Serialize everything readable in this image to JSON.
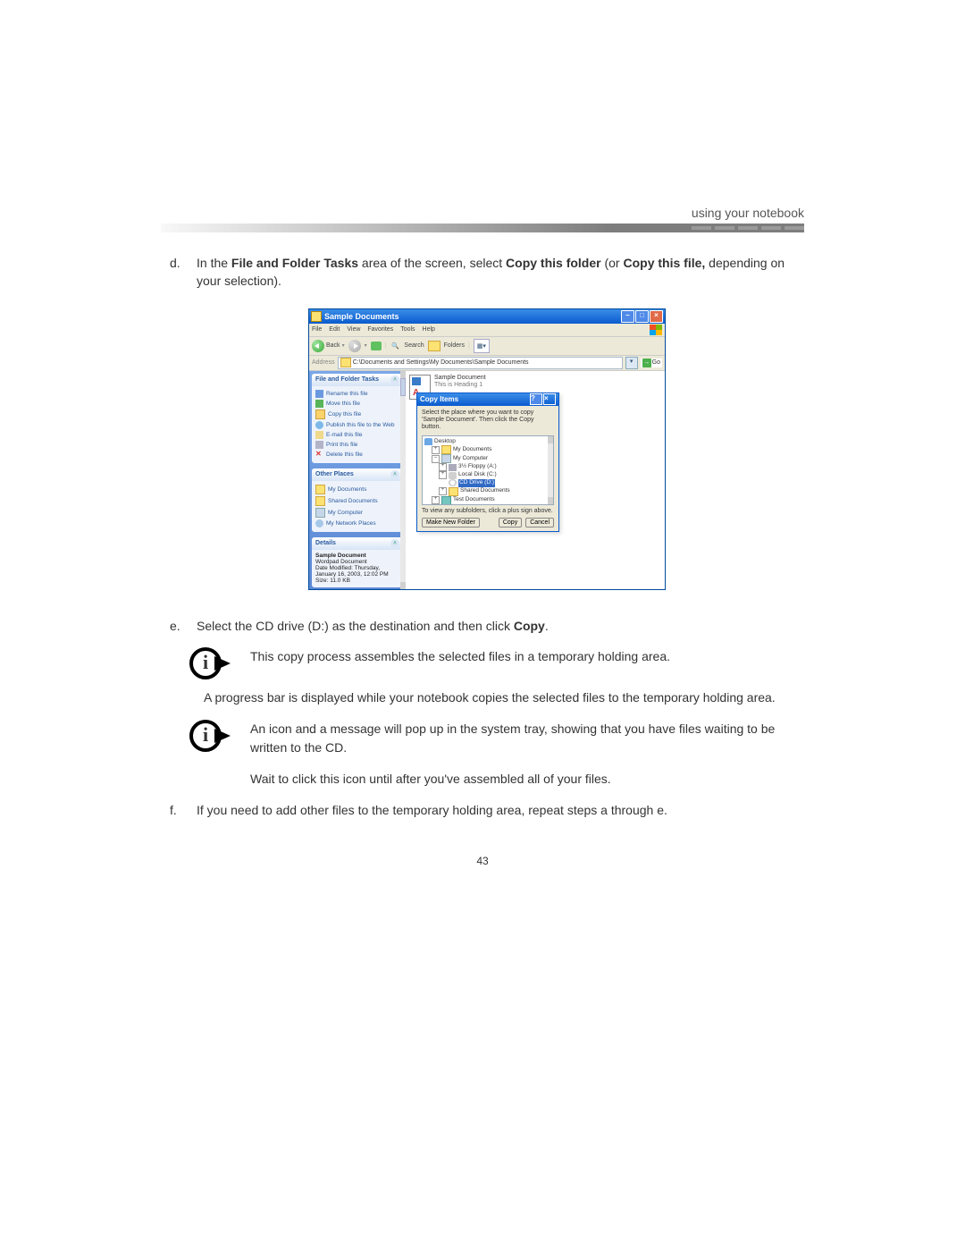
{
  "header": {
    "title": "using your notebook"
  },
  "steps": {
    "d": {
      "letter": "d.",
      "part1": "In the ",
      "bold1": "File and Folder Tasks",
      "part2": " area of the screen, select ",
      "bold2": "Copy this folder",
      "part3": " (or ",
      "bold3": "Copy this file,",
      "part4": " depending on your selection)."
    },
    "e": {
      "letter": "e.",
      "part1": "Select the CD drive (D:) as the destination and then click ",
      "bold1": "Copy",
      "part2": "."
    },
    "f": {
      "letter": "f.",
      "text": "If you need to add other files to the temporary holding area, repeat steps a through e."
    }
  },
  "notes": {
    "n1": "This copy process assembles the selected files in a temporary holding area.",
    "after_n1": "A progress bar is displayed while your notebook copies the selected files to the temporary holding area.",
    "n2a": "An icon and a message will pop up in the system tray, showing that you have files waiting to be written to the CD.",
    "n2b": "Wait to click this icon until after you've assembled all of your files."
  },
  "page_number": "43",
  "xp": {
    "title": "Sample Documents",
    "menu": [
      "File",
      "Edit",
      "View",
      "Favorites",
      "Tools",
      "Help"
    ],
    "toolbar": {
      "back": "Back",
      "search": "Search",
      "folders": "Folders"
    },
    "address": {
      "label": "Address",
      "path": "C:\\Documents and Settings\\My Documents\\Sample Documents",
      "go": "Go"
    },
    "sidebar": {
      "panel1": {
        "title": "File and Folder Tasks",
        "items": [
          "Rename this file",
          "Move this file",
          "Copy this file",
          "Publish this file to the Web",
          "E-mail this file",
          "Print this file",
          "Delete this file"
        ]
      },
      "panel2": {
        "title": "Other Places",
        "items": [
          "My Documents",
          "Shared Documents",
          "My Computer",
          "My Network Places"
        ]
      },
      "panel3": {
        "title": "Details",
        "name": "Sample Document",
        "type": "Wordpad Document",
        "modified": "Date Modified: Thursday, January 16, 2003, 12:02 PM",
        "size": "Size: 11.0 KB"
      }
    },
    "file": {
      "name": "Sample Document",
      "sub": "This is Heading 1"
    },
    "dialog": {
      "title": "Copy Items",
      "msg": "Select the place where you want to copy 'Sample Document'. Then click the Copy button.",
      "tree": {
        "desktop": "Desktop",
        "mydocs": "My Documents",
        "mycomp": "My Computer",
        "floppy": "3½ Floppy (A:)",
        "localc": "Local Disk (C:)",
        "cdrom": "CD Drive (D:)",
        "shared": "Shared Documents",
        "test": "Test Documents"
      },
      "hint": "To view any subfolders, click a plus sign above.",
      "buttons": {
        "new": "Make New Folder",
        "copy": "Copy",
        "cancel": "Cancel"
      }
    }
  }
}
